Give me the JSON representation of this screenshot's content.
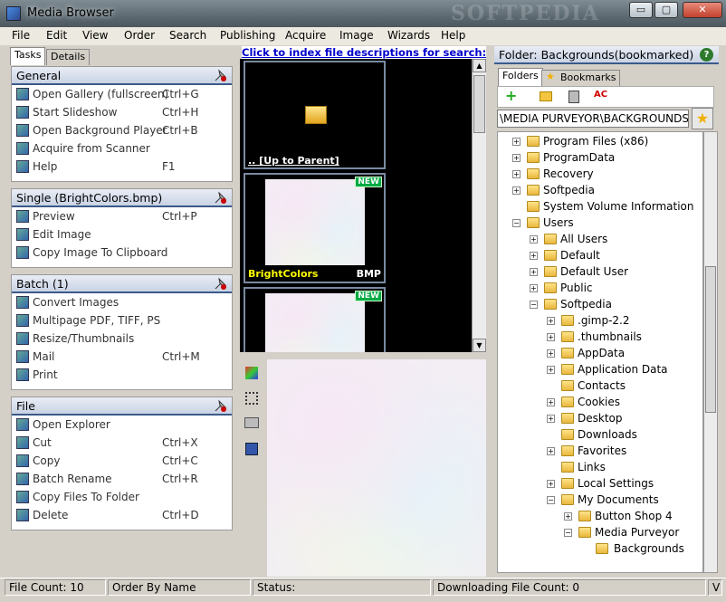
{
  "window": {
    "title": "Media Browser",
    "controls": {
      "minimize": "▭",
      "maximize": "▢",
      "close": "✕"
    }
  },
  "menu": [
    "File",
    "Edit",
    "View",
    "Order",
    "Search",
    "Publishing",
    "Acquire",
    "Image",
    "Wizards",
    "Help"
  ],
  "left": {
    "tabs": [
      "Tasks",
      "Details"
    ],
    "sections": [
      {
        "title": "General",
        "items": [
          {
            "icon": "gallery-icon",
            "label": "Open Gallery (fullscreen)",
            "shortcut": "Ctrl+G"
          },
          {
            "icon": "slideshow-icon",
            "label": "Start Slideshow",
            "shortcut": "Ctrl+H"
          },
          {
            "icon": "music-icon",
            "label": "Open Background Player",
            "shortcut": "Ctrl+B"
          },
          {
            "icon": "scanner-icon",
            "label": "Acquire from Scanner",
            "shortcut": ""
          },
          {
            "icon": "help-icon",
            "label": "Help",
            "shortcut": "F1"
          }
        ]
      },
      {
        "title": "Single (BrightColors.bmp)",
        "items": [
          {
            "icon": "preview-icon",
            "label": "Preview",
            "shortcut": "Ctrl+P"
          },
          {
            "icon": "edit-icon",
            "label": "Edit Image",
            "shortcut": ""
          },
          {
            "icon": "clipboard-icon",
            "label": "Copy Image To Clipboard",
            "shortcut": ""
          }
        ]
      },
      {
        "title": "Batch (1)",
        "items": [
          {
            "icon": "convert-icon",
            "label": "Convert Images",
            "shortcut": ""
          },
          {
            "icon": "pdf-icon",
            "label": "Multipage PDF, TIFF, PS",
            "shortcut": ""
          },
          {
            "icon": "resize-icon",
            "label": "Resize/Thumbnails",
            "shortcut": ""
          },
          {
            "icon": "mail-icon",
            "label": "Mail",
            "shortcut": "Ctrl+M"
          },
          {
            "icon": "print-icon",
            "label": "Print",
            "shortcut": ""
          }
        ]
      },
      {
        "title": "File",
        "items": [
          {
            "icon": "explorer-icon",
            "label": "Open Explorer",
            "shortcut": ""
          },
          {
            "icon": "cut-icon",
            "label": "Cut",
            "shortcut": "Ctrl+X"
          },
          {
            "icon": "copy-icon",
            "label": "Copy",
            "shortcut": "Ctrl+C"
          },
          {
            "icon": "rename-icon",
            "label": "Batch Rename",
            "shortcut": "Ctrl+R"
          },
          {
            "icon": "copy-folder-icon",
            "label": "Copy Files To Folder",
            "shortcut": ""
          },
          {
            "icon": "delete-icon",
            "label": "Delete",
            "shortcut": "Ctrl+D"
          }
        ]
      }
    ]
  },
  "middle": {
    "link": "Click to index file descriptions for search: New",
    "thumbs": [
      {
        "label": ".. [Up to Parent]"
      },
      {
        "name": "BrightColors",
        "type": "BMP",
        "badge": "NEW"
      },
      {
        "badge": "NEW"
      }
    ]
  },
  "right": {
    "header": "Folder: Backgrounds(bookmarked)",
    "help": "?",
    "tabs": [
      "Folders",
      "Bookmarks"
    ],
    "path": "\\MEDIA PURVEYOR\\BACKGROUNDS\\",
    "tree": [
      {
        "label": "Program Files (x86)",
        "level": 0,
        "exp": "+"
      },
      {
        "label": "ProgramData",
        "level": 0,
        "exp": "+"
      },
      {
        "label": "Recovery",
        "level": 0,
        "exp": "+"
      },
      {
        "label": "Softpedia",
        "level": 0,
        "exp": "+"
      },
      {
        "label": "System Volume Information",
        "level": 0,
        "exp": ""
      },
      {
        "label": "Users",
        "level": 0,
        "exp": "−"
      },
      {
        "label": "All Users",
        "level": 1,
        "exp": "+"
      },
      {
        "label": "Default",
        "level": 1,
        "exp": "+"
      },
      {
        "label": "Default User",
        "level": 1,
        "exp": "+"
      },
      {
        "label": "Public",
        "level": 1,
        "exp": "+"
      },
      {
        "label": "Softpedia",
        "level": 1,
        "exp": "−"
      },
      {
        "label": ".gimp-2.2",
        "level": 2,
        "exp": "+"
      },
      {
        "label": ".thumbnails",
        "level": 2,
        "exp": "+"
      },
      {
        "label": "AppData",
        "level": 2,
        "exp": "+"
      },
      {
        "label": "Application Data",
        "level": 2,
        "exp": "+"
      },
      {
        "label": "Contacts",
        "level": 2,
        "exp": ""
      },
      {
        "label": "Cookies",
        "level": 2,
        "exp": "+"
      },
      {
        "label": "Desktop",
        "level": 2,
        "exp": "+"
      },
      {
        "label": "Downloads",
        "level": 2,
        "exp": ""
      },
      {
        "label": "Favorites",
        "level": 2,
        "exp": "+"
      },
      {
        "label": "Links",
        "level": 2,
        "exp": ""
      },
      {
        "label": "Local Settings",
        "level": 2,
        "exp": "+"
      },
      {
        "label": "My Documents",
        "level": 2,
        "exp": "−"
      },
      {
        "label": "Button Shop 4",
        "level": 3,
        "exp": "+"
      },
      {
        "label": "Media Purveyor",
        "level": 3,
        "exp": "−"
      },
      {
        "label": "Backgrounds",
        "level": 4,
        "exp": ""
      }
    ]
  },
  "status": {
    "file_count": "File Count: 10",
    "order": "Order By Name",
    "status": "Status:",
    "downloading": "Downloading File Count: 0",
    "tail": "V"
  },
  "watermark": "SOFTPEDIA"
}
